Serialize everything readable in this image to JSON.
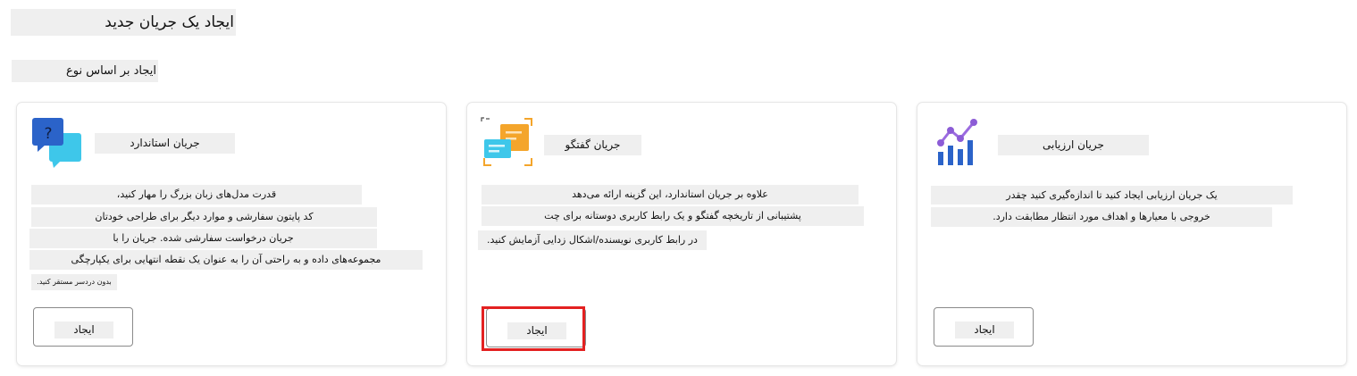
{
  "page": {
    "title": "ایجاد یک جریان جدید"
  },
  "section": {
    "label": "ایجاد بر اساس نوع"
  },
  "cards": [
    {
      "title": "جریان استاندارد",
      "icon": "chat-question-icon",
      "desc": [
        "قدرت مدل‌های زبان بزرگ را مهار کنید،",
        "کد پایتون سفارشی و موارد دیگر برای طراحی خودتان",
        "جریان درخواست سفارشی شده. جریان را با",
        "مجموعه‌های داده و به راحتی آن را به عنوان یک نقطه انتهایی برای یکپارچگی",
        "بدون دردسر مستقر کنید."
      ],
      "button": "ایجاد"
    },
    {
      "title": "جریان گفتگو",
      "icon": "chat-flow-icon",
      "desc": [
        "علاوه بر جریان استاندارد، این گزینه ارائه می‌دهد",
        "پشتیبانی از تاریخچه گفتگو و یک رابط کاربری دوستانه برای چت",
        "در رابط کاربری نویسنده/اشکال زدایی آزمایش کنید."
      ],
      "button": "ایجاد"
    },
    {
      "title": "جریان ارزیابی",
      "icon": "evaluation-chart-icon",
      "desc": [
        "یک جریان ارزیابی ایجاد کنید تا اندازه‌گیری کنید چقدر",
        "خروجی با معیارها و اهداف مورد انتظار مطابقت دارد."
      ],
      "button": "ایجاد"
    }
  ],
  "colors": {
    "highlight": "#e32121",
    "icon_blue": "#2b63c9",
    "icon_orange": "#f4a52b",
    "icon_purple": "#8c5cd6"
  }
}
